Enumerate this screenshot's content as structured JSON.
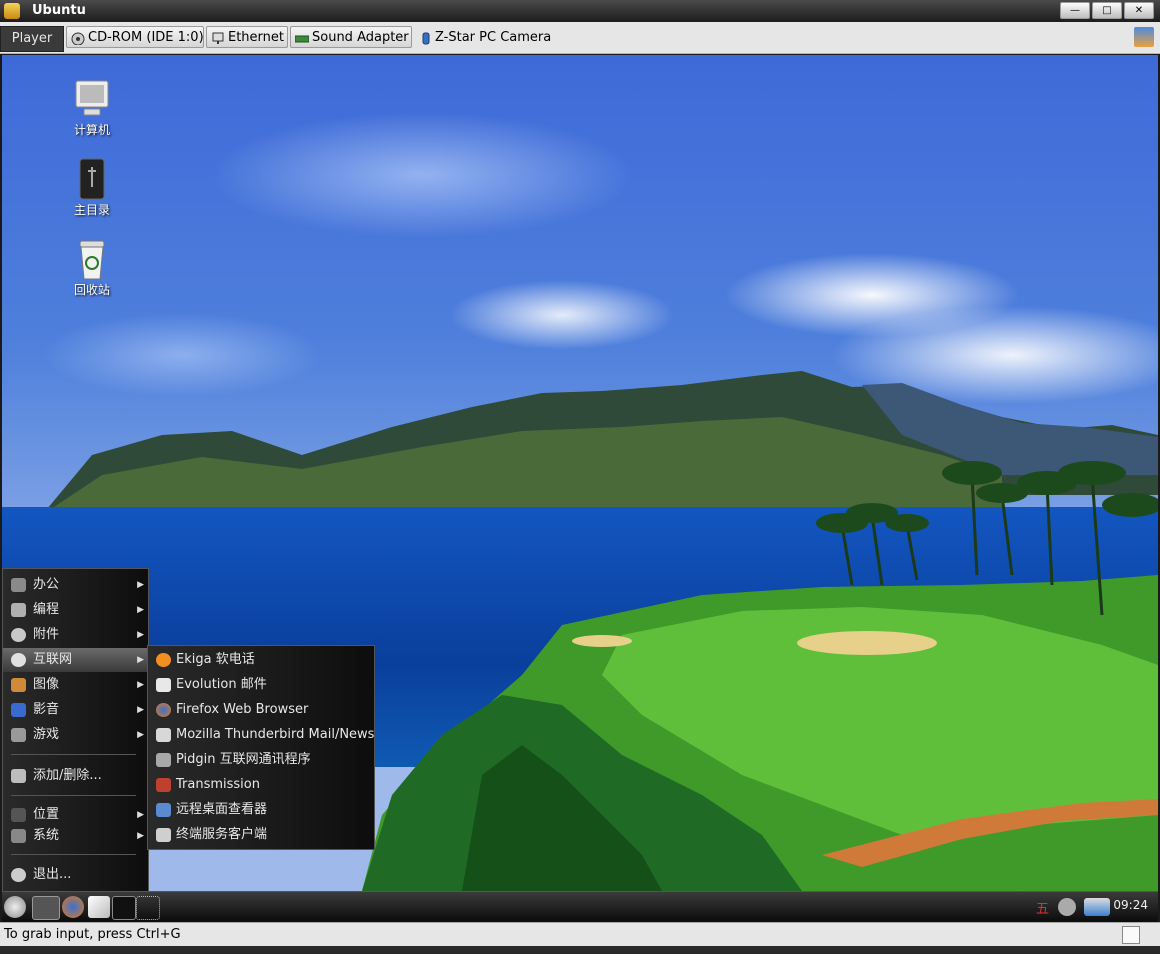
{
  "window": {
    "title": "Ubuntu",
    "controls": [
      "minimize",
      "maximize",
      "close"
    ]
  },
  "toolbar": {
    "player_label": "Player",
    "devices": [
      {
        "label": "CD-ROM (IDE 1:0)",
        "icon": "cdrom-icon"
      },
      {
        "label": "Ethernet",
        "icon": "network-icon"
      },
      {
        "label": "Sound Adapter",
        "icon": "sound-card-icon"
      },
      {
        "label": "Z-Star PC Camera",
        "icon": "usb-camera-icon"
      }
    ]
  },
  "desktop_icons": [
    {
      "label": "计算机",
      "icon": "computer-icon"
    },
    {
      "label": "主目录",
      "icon": "home-folder-icon"
    },
    {
      "label": "回收站",
      "icon": "trash-icon"
    }
  ],
  "main_menu": {
    "items": [
      {
        "label": "办公",
        "icon": "office-icon",
        "has_submenu": true
      },
      {
        "label": "编程",
        "icon": "programming-icon",
        "has_submenu": true
      },
      {
        "label": "附件",
        "icon": "accessories-icon",
        "has_submenu": true
      },
      {
        "label": "互联网",
        "icon": "internet-icon",
        "has_submenu": true,
        "active": true
      },
      {
        "label": "图像",
        "icon": "graphics-icon",
        "has_submenu": true
      },
      {
        "label": "影音",
        "icon": "multimedia-icon",
        "has_submenu": true
      },
      {
        "label": "游戏",
        "icon": "games-icon",
        "has_submenu": true
      }
    ],
    "add_remove": "添加/删除...",
    "places": "位置",
    "system": "系统",
    "logout": "退出..."
  },
  "internet_submenu": {
    "items": [
      {
        "label": "Ekiga 软电话",
        "icon": "ekiga-icon"
      },
      {
        "label": "Evolution 邮件",
        "icon": "evolution-icon"
      },
      {
        "label": "Firefox Web Browser",
        "icon": "firefox-icon"
      },
      {
        "label": "Mozilla Thunderbird Mail/News",
        "icon": "thunderbird-icon"
      },
      {
        "label": "Pidgin 互联网通讯程序",
        "icon": "pidgin-icon"
      },
      {
        "label": "Transmission",
        "icon": "transmission-icon"
      },
      {
        "label": "远程桌面查看器",
        "icon": "remote-desktop-icon"
      },
      {
        "label": "终端服务客户端",
        "icon": "terminal-server-icon"
      }
    ]
  },
  "taskbar": {
    "launchers": [
      "main-menu-icon",
      "show-desktop-icon",
      "firefox-icon",
      "evolution-icon",
      "terminal-icon",
      "network-icon"
    ],
    "tray_input": "五",
    "clock": "09:24"
  },
  "statusbar": {
    "message": "To grab input, press Ctrl+G"
  },
  "colors": {
    "menu_bg": "#1a1a1a",
    "taskbar_bg": "#202020",
    "toolbar_bg": "#e6e6e6",
    "player_bg": "#3a3a3a"
  }
}
